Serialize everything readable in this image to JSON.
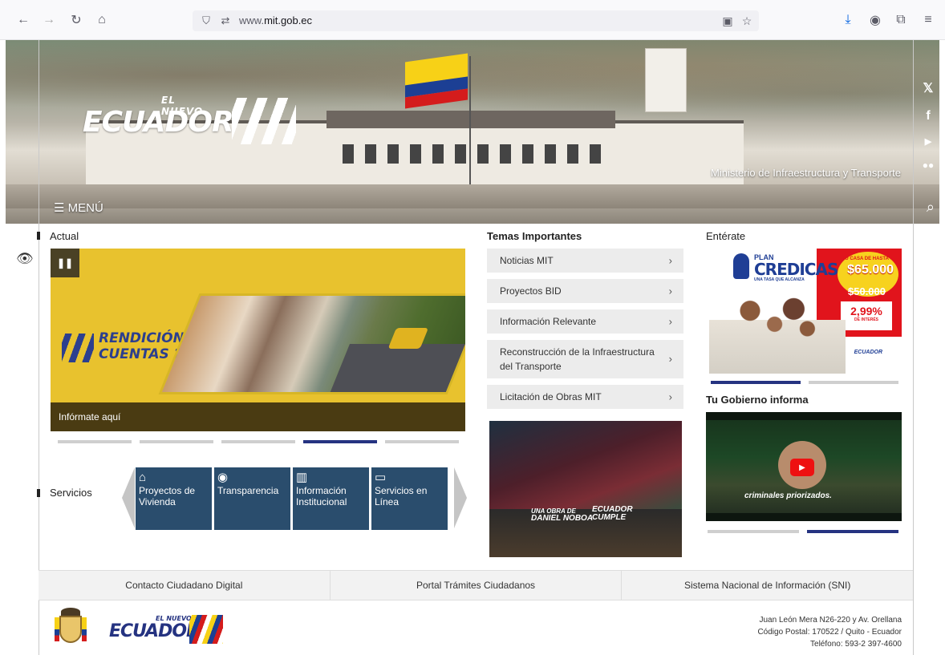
{
  "browser": {
    "url_prefix": "www.",
    "url_domain": "mit.gob.ec",
    "icons": [
      "back-icon",
      "forward-icon",
      "reload-icon",
      "home-icon",
      "shield-icon",
      "permissions-icon",
      "reader-icon",
      "bookmark-star-icon",
      "download-icon",
      "account-icon",
      "extensions-icon",
      "menu-icon"
    ]
  },
  "hero": {
    "brand_small": "EL NUEVO",
    "brand_big": "ECUADOR",
    "ministry": "Ministerio de Infraestructura y Transporte",
    "menu_label": "MENÚ",
    "social": [
      "x-icon",
      "facebook-icon",
      "youtube-icon",
      "flickr-icon"
    ]
  },
  "actual": {
    "label": "Actual",
    "banner_line1": "RENDICIÓN DE",
    "banner_line2": "CUENTAS 2025",
    "caption": "Infórmate aquí",
    "indicators": [
      false,
      false,
      false,
      true,
      false
    ]
  },
  "servicios": {
    "label": "Servicios",
    "items": [
      {
        "icon": "house-icon",
        "label": "Proyectos de Vivienda"
      },
      {
        "icon": "eye-icon",
        "label": "Transparencia"
      },
      {
        "icon": "buildings-icon",
        "label": "Información Institucional"
      },
      {
        "icon": "monitor-icon",
        "label": "Servicios en Línea"
      }
    ]
  },
  "temas": {
    "label": "Temas Importantes",
    "items": [
      "Noticias MIT",
      "Proyectos BID",
      "Información Relevante",
      "Reconstrucción de la Infraestructura del Transporte",
      "Licitación de Obras MIT"
    ],
    "video_text_1": "UNA OBRA DE",
    "video_text_2": "DANIEL NOBOA",
    "video_logo_1": "ECUADOR",
    "video_logo_2": "CUMPLE"
  },
  "enterate": {
    "label": "Entérate",
    "plan_line1": "PLAN",
    "plan_line2": "CREDICASA",
    "plan_line3": "UNA TASA QUE ALCANZA",
    "burst_pre": "TU CASA DE HASTA",
    "amount": "$65.000",
    "old_amount": "$50.000",
    "rate_value": "2,99%",
    "rate_label": "DE INTERÉS",
    "eco_text": "ECUADOR",
    "indicators": [
      true,
      false
    ]
  },
  "gobierno": {
    "label": "Tu Gobierno informa",
    "video_caption": "criminales priorizados.",
    "indicators": [
      false,
      true
    ]
  },
  "footer": {
    "links": [
      "Contacto Ciudadano Digital",
      "Portal Trámites Ciudadanos",
      "Sistema Nacional de Información (SNI)"
    ],
    "logo_small": "EL NUEVO",
    "logo_big": "ECUADOR",
    "address_1": "Juan León Mera N26-220 y Av. Orellana",
    "address_2": "Código Postal: 170522 / Quito - Ecuador",
    "address_3": "Teléfono: 593-2 397-4600"
  }
}
